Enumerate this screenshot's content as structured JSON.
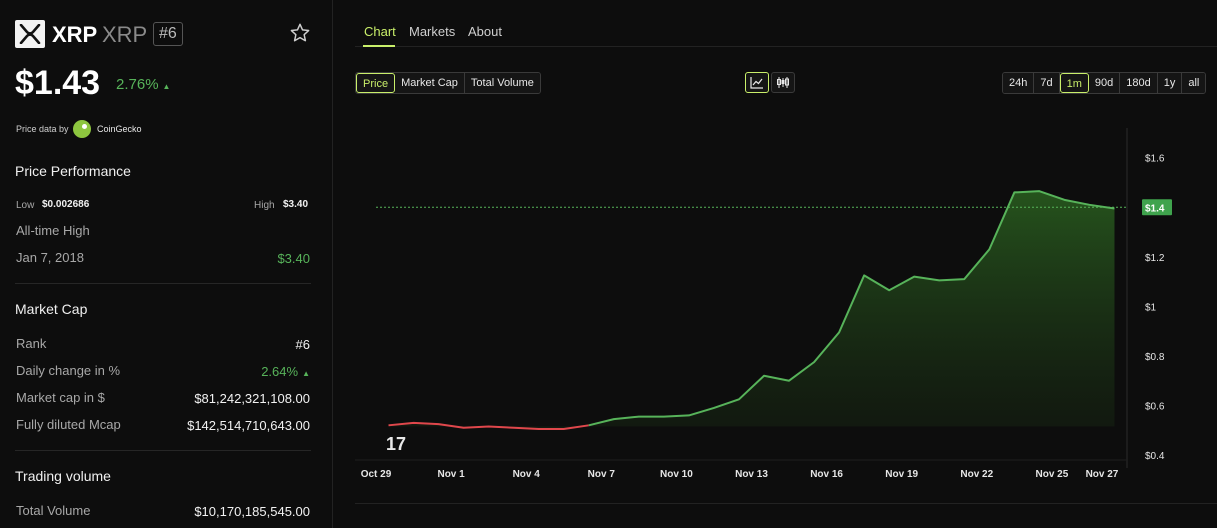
{
  "coin": {
    "symbol": "XRP",
    "name": "XRP",
    "rank_badge": "#6",
    "price": "$1.43",
    "change": "2.76%",
    "change_arrow": "▲",
    "price_data_by": "Price data by",
    "provider": "CoinGecko"
  },
  "price_performance": {
    "title": "Price Performance",
    "low_label": "Low",
    "low_value": "$0.002686",
    "high_label": "High",
    "high_value": "$3.40",
    "ath_label": "All-time High",
    "ath_date": "Jan 7, 2018",
    "ath_value": "$3.40"
  },
  "market_cap": {
    "title": "Market Cap",
    "rows": [
      {
        "label": "Rank",
        "value": "#6"
      },
      {
        "label": "Daily change in %",
        "value": "2.64%",
        "arrow": "▲"
      },
      {
        "label": "Market cap in $",
        "value": "$81,242,321,108.00"
      },
      {
        "label": "Fully diluted Mcap",
        "value": "$142,514,710,643.00"
      }
    ]
  },
  "trading_volume": {
    "title": "Trading volume",
    "total_label": "Total Volume",
    "total_value": "$10,170,185,545.00"
  },
  "tabs": [
    {
      "label": "Chart",
      "active": true
    },
    {
      "label": "Markets",
      "active": false
    },
    {
      "label": "About",
      "active": false
    }
  ],
  "metric_buttons": [
    {
      "label": "Price",
      "active": true
    },
    {
      "label": "Market Cap",
      "active": false
    },
    {
      "label": "Total Volume",
      "active": false
    }
  ],
  "chart_type_buttons": [
    {
      "icon": "line-chart-icon",
      "active": true
    },
    {
      "icon": "candlestick-icon",
      "active": false
    }
  ],
  "range_buttons": [
    {
      "label": "24h",
      "active": false
    },
    {
      "label": "7d",
      "active": false
    },
    {
      "label": "1m",
      "active": true
    },
    {
      "label": "90d",
      "active": false
    },
    {
      "label": "180d",
      "active": false
    },
    {
      "label": "1y",
      "active": false
    },
    {
      "label": "all",
      "active": false
    }
  ],
  "colors": {
    "accent": "#c9ef6a",
    "up": "#57b35a",
    "down": "#e0474c",
    "price_tag": "#3fa34d"
  },
  "chart_data": {
    "type": "area",
    "x_tick_labels": [
      "Oct 29",
      "Nov 1",
      "Nov 4",
      "Nov 7",
      "Nov 10",
      "Nov 13",
      "Nov 16",
      "Nov 19",
      "Nov 22",
      "Nov 25",
      "Nov 27"
    ],
    "x_ticks_day": [
      0,
      3,
      6,
      9,
      12,
      15,
      18,
      21,
      24,
      27,
      29
    ],
    "x_range_day": [
      0,
      30
    ],
    "y_ticks": [
      0.4,
      0.6,
      0.8,
      1.0,
      1.2,
      1.4,
      1.6
    ],
    "y_tick_labels": [
      "$0.4",
      "$0.6",
      "$0.8",
      "$1",
      "$1.2",
      "$1.4",
      "$1.6"
    ],
    "ylim": [
      0.38,
      1.72
    ],
    "current_price_label": "$1.4",
    "current_price": 1.4,
    "series": [
      {
        "day": [
          0.5,
          1.5,
          2.5,
          3.5,
          4.5,
          5.5,
          6.5,
          7.5,
          8.5,
          9.5,
          10.5,
          11.5,
          12.5,
          13.5,
          14.5,
          15.5,
          16.5,
          17.5,
          18.5,
          19.5,
          20.5,
          21.5,
          22.5,
          23.5,
          24.5,
          25.5,
          26.5,
          27.5,
          28.5,
          29.5
        ],
        "price": [
          0.52,
          0.53,
          0.525,
          0.51,
          0.515,
          0.51,
          0.505,
          0.505,
          0.52,
          0.545,
          0.555,
          0.555,
          0.56,
          0.59,
          0.625,
          0.72,
          0.7,
          0.775,
          0.895,
          1.125,
          1.065,
          1.12,
          1.105,
          1.11,
          1.23,
          1.46,
          1.465,
          1.43,
          1.41,
          1.395
        ]
      }
    ],
    "down_segment_last_day": 8.5
  }
}
